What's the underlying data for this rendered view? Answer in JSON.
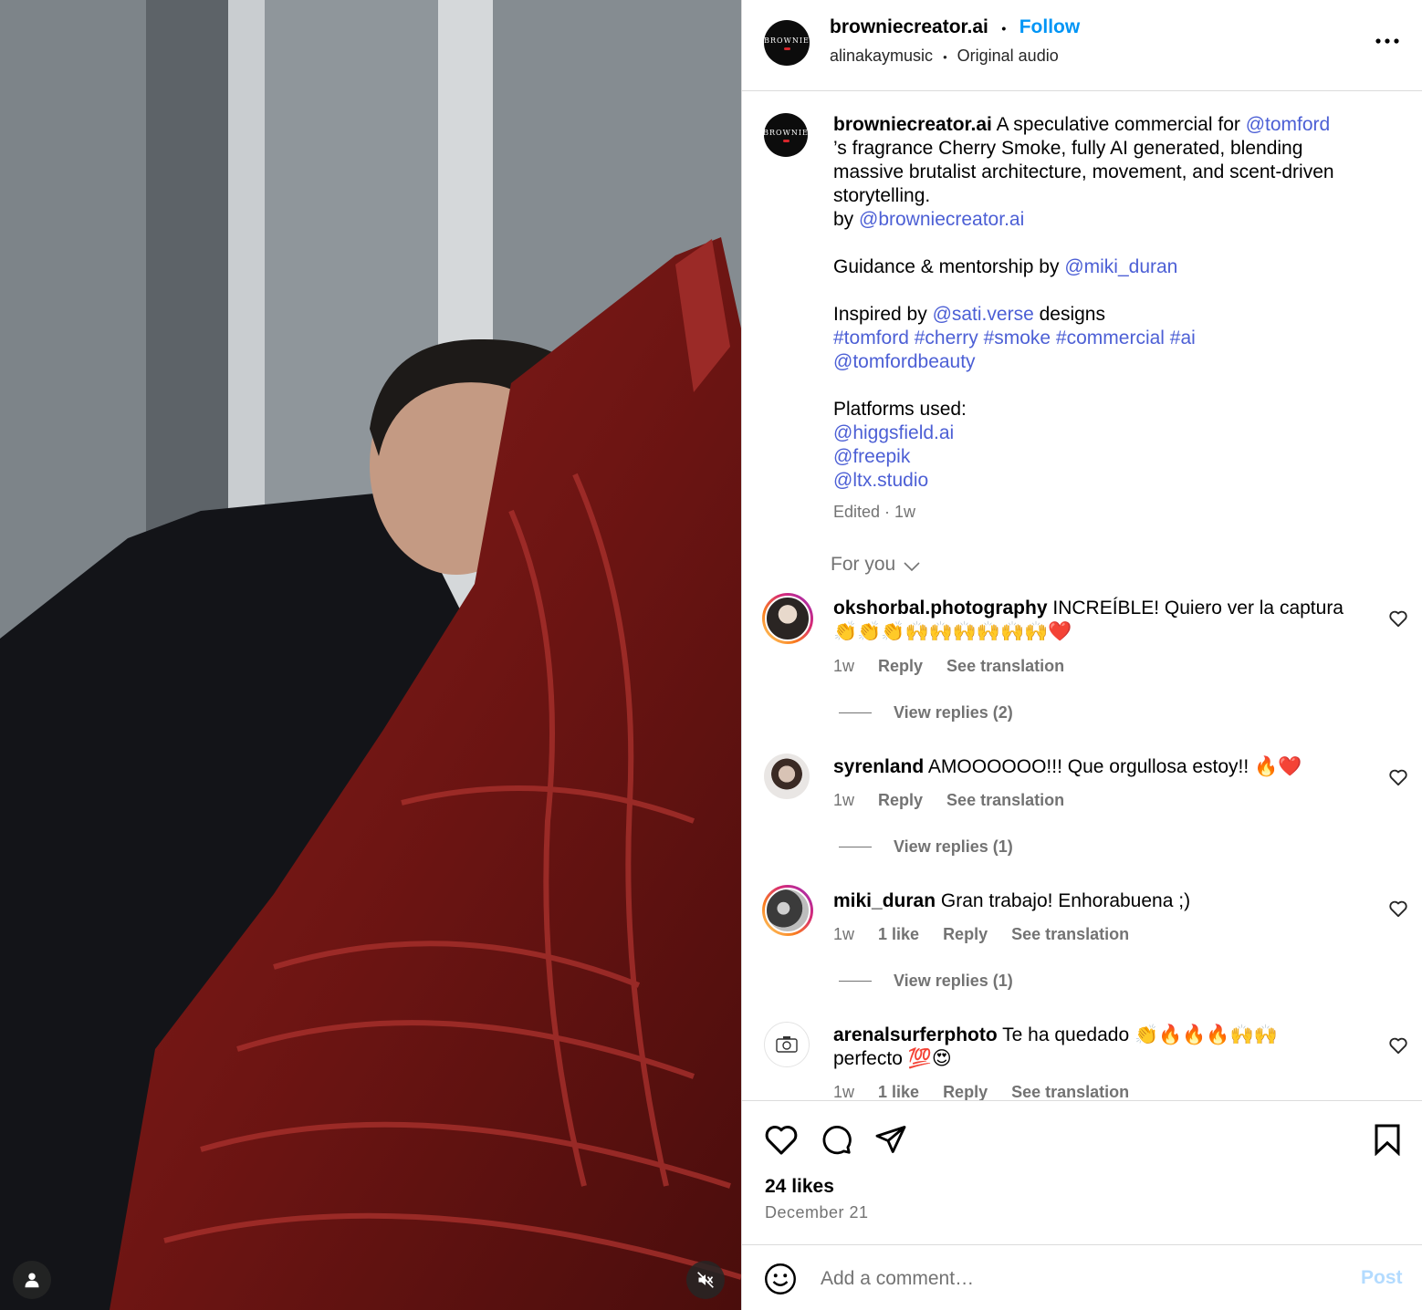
{
  "post": {
    "username": "browniecreator.ai",
    "follow_label": "Follow",
    "separator": "•",
    "audio_artist": "alinakaymusic",
    "audio_sep": "•",
    "audio_label": "Original audio",
    "logo_text": "BROWNIE",
    "more_label": "•••"
  },
  "caption": {
    "username": "browniecreator.ai",
    "l1_text": "A speculative commercial for ",
    "l1_mention": "@tomford",
    "l2": "’s fragrance Cherry Smoke, fully AI generated, blending",
    "l3": "massive brutalist architecture, movement, and scent-driven",
    "l4": "storytelling.",
    "l5_text": "by ",
    "l5_mention": "@browniecreator.ai",
    "l6_text": "Guidance & mentorship by ",
    "l6_mention": "@miki_duran",
    "l7_text": "Inspired by ",
    "l7_mention": "@sati.verse",
    "l7_after": " designs",
    "hashtags": "#tomford #cherry #smoke #commercial #ai",
    "l9_mention": "@tomfordbeauty",
    "platforms_label": "Platforms used:",
    "p1": "@higgsfield.ai",
    "p2": "@freepik",
    "p3": "@ltx.studio",
    "edited": "Edited · 1w"
  },
  "sort_label": "For you",
  "comments": [
    {
      "user": "okshorbal.photography",
      "text1": "INCREÍBLE! Quiero ver la captura",
      "text2": "👏👏👏🙌🙌🙌🙌🙌🙌❤️",
      "time": "1w",
      "reply": "Reply",
      "translate": "See translation",
      "replies": "View replies (2)"
    },
    {
      "user": "syrenland",
      "text1": "AMOOOOOO!!! Que orgullosa estoy!! 🔥❤️",
      "time": "1w",
      "reply": "Reply",
      "translate": "See translation",
      "replies": "View replies (1)"
    },
    {
      "user": "miki_duran",
      "text1": "Gran trabajo! Enhorabuena ;)",
      "time": "1w",
      "likes": "1 like",
      "reply": "Reply",
      "translate": "See translation",
      "replies": "View replies (1)"
    },
    {
      "user": "arenalsurferphoto",
      "text1": "Te ha quedado 👏🔥🔥🔥🙌🙌",
      "text2": "perfecto 💯😍",
      "time": "1w",
      "likes": "1 like",
      "reply": "Reply",
      "translate": "See translation"
    }
  ],
  "stats": {
    "likes": "24 likes",
    "date": "December 21"
  },
  "add_comment": {
    "placeholder": "Add a comment…",
    "post_label": "Post"
  },
  "colors": {
    "link": "#4c5fd5",
    "follow": "#0095f6",
    "muted": "#737373",
    "post_disabled": "#b3dbff"
  }
}
